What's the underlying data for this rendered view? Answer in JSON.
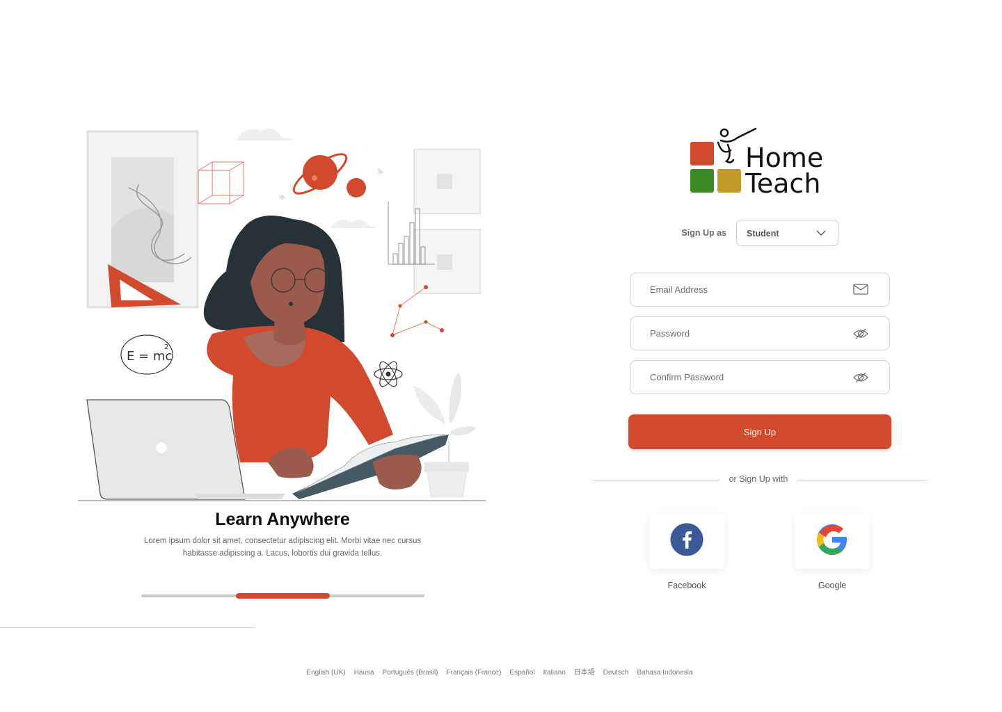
{
  "hero": {
    "title": "Learn Anywhere",
    "description": "Lorem ipsum dolor sit amet, consectetur adipiscing elit. Morbi vitae nec cursus habitasse adipiscing a. Lacus, lobortis dui gravida tellus.",
    "carousel": {
      "slides": 3,
      "active_index": 1
    }
  },
  "illustration": {
    "formula": "E = mc",
    "formula_exp": "2"
  },
  "logo": {
    "line1": "Home",
    "line2": "Teach",
    "colors": [
      "#d14a2e",
      "#3d8b25",
      "#c49a2a"
    ]
  },
  "signup_as": {
    "label": "Sign Up as",
    "selected": "Student"
  },
  "form": {
    "email_placeholder": "Email Address",
    "password_placeholder": "Password",
    "confirm_placeholder": "Confirm Password",
    "submit_label": "Sign Up"
  },
  "social": {
    "divider_text": "or Sign Up with",
    "facebook_label": "Facebook",
    "google_label": "Google"
  },
  "languages": [
    "English (UK)",
    "Hausa",
    "Português (Brasil)",
    "Français (France)",
    "Español",
    "Italiano",
    "日本語",
    "Deutsch",
    "Bahasa Indonesia"
  ],
  "colors": {
    "accent": "#d14a2e",
    "facebook": "#3b5998"
  }
}
